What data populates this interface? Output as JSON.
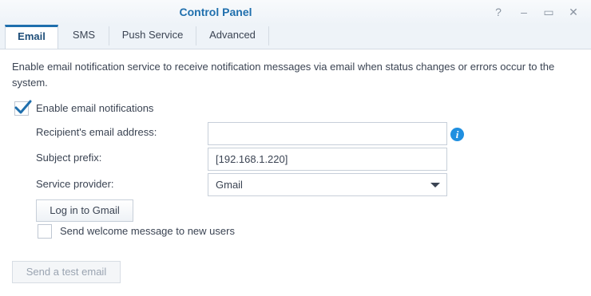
{
  "window": {
    "title": "Control Panel",
    "help_glyph": "?",
    "minimize_glyph": "–",
    "maximize_glyph": "▭",
    "close_glyph": "✕"
  },
  "tabs": [
    {
      "label": "Email",
      "active": true
    },
    {
      "label": "SMS",
      "active": false
    },
    {
      "label": "Push Service",
      "active": false
    },
    {
      "label": "Advanced",
      "active": false
    }
  ],
  "description": "Enable email notification service to receive notification messages via email when status changes or errors occur to the system.",
  "enable_email": {
    "label": "Enable email notifications",
    "checked": true
  },
  "recipient": {
    "label": "Recipient's email address:",
    "value": ""
  },
  "subject_prefix": {
    "label": "Subject prefix:",
    "value": "[192.168.1.220]"
  },
  "service_provider": {
    "label": "Service provider:",
    "value": "Gmail"
  },
  "login_button": "Log in to Gmail",
  "welcome_message": {
    "label": "Send welcome message to new users",
    "checked": false
  },
  "test_button": "Send a test email",
  "colors": {
    "accent": "#1f6fad",
    "info": "#1f8fe0",
    "check": "#1f6fad"
  }
}
